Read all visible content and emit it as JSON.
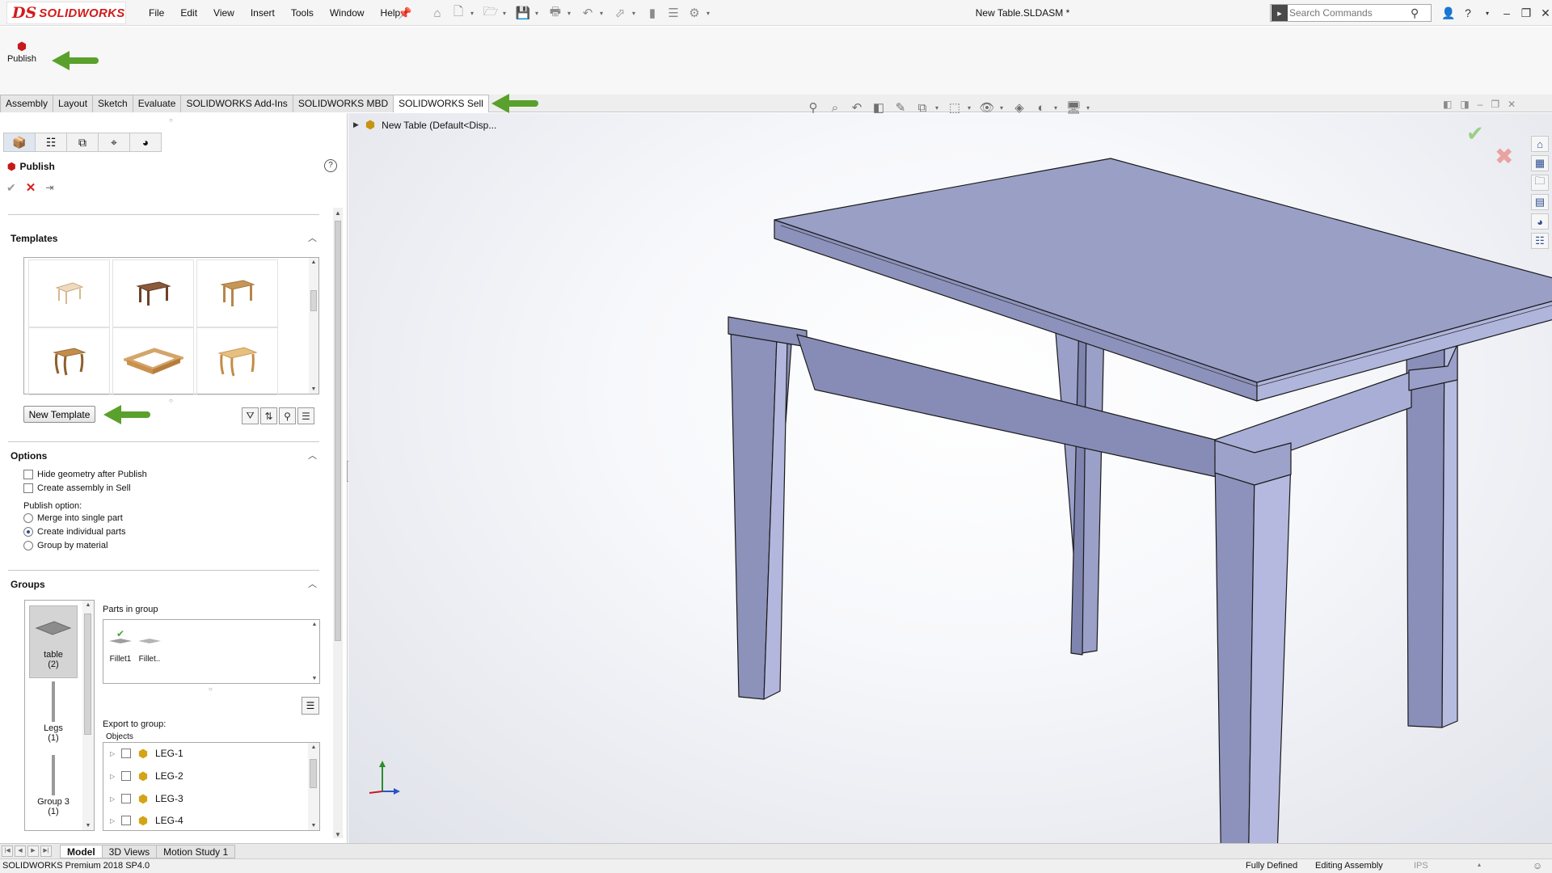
{
  "app": {
    "brand_prefix": "DS",
    "brand_name": "SOLIDWORKS",
    "document_title": "New Table.SLDASM *"
  },
  "menu": [
    "File",
    "Edit",
    "View",
    "Insert",
    "Tools",
    "Window",
    "Help"
  ],
  "search": {
    "placeholder": "Search Commands"
  },
  "command_manager": {
    "publish_label": "Publish"
  },
  "tabs": [
    "Assembly",
    "Layout",
    "Sketch",
    "Evaluate",
    "SOLIDWORKS Add-Ins",
    "SOLIDWORKS MBD",
    "SOLIDWORKS Sell"
  ],
  "active_tab": "SOLIDWORKS Sell",
  "property_manager": {
    "title": "Publish",
    "templates": {
      "header": "Templates",
      "new_template_label": "New Template"
    },
    "options": {
      "header": "Options",
      "hide_geometry": "Hide geometry after Publish",
      "create_assembly": "Create assembly in Sell",
      "publish_option_label": "Publish option:",
      "merge": "Merge into single part",
      "individual": "Create individual parts",
      "by_material": "Group by material",
      "selected_option": "Create individual parts"
    },
    "groups": {
      "header": "Groups",
      "items": [
        {
          "name": "table",
          "count": "(2)"
        },
        {
          "name": "Legs",
          "count": "(1)"
        },
        {
          "name": "Group 3",
          "count": "(1)"
        }
      ],
      "parts_in_group_label": "Parts in group",
      "parts": [
        "Fillet1",
        "Fillet.."
      ],
      "export_label": "Export to group:",
      "objects_label": "Objects",
      "objects": [
        "LEG-1",
        "LEG-2",
        "LEG-3",
        "LEG-4"
      ]
    }
  },
  "viewport": {
    "tree_root": "New Table  (Default<Disp..."
  },
  "bottom_tabs": [
    "Model",
    "3D Views",
    "Motion Study 1"
  ],
  "active_bottom_tab": "Model",
  "status": {
    "version": "SOLIDWORKS Premium 2018 SP4.0",
    "definition": "Fully Defined",
    "mode": "Editing Assembly",
    "units": "IPS"
  },
  "colors": {
    "accent_arrow": "#5aa02c",
    "brand_red": "#d11b1b",
    "model_face": "#9a9fc6"
  }
}
